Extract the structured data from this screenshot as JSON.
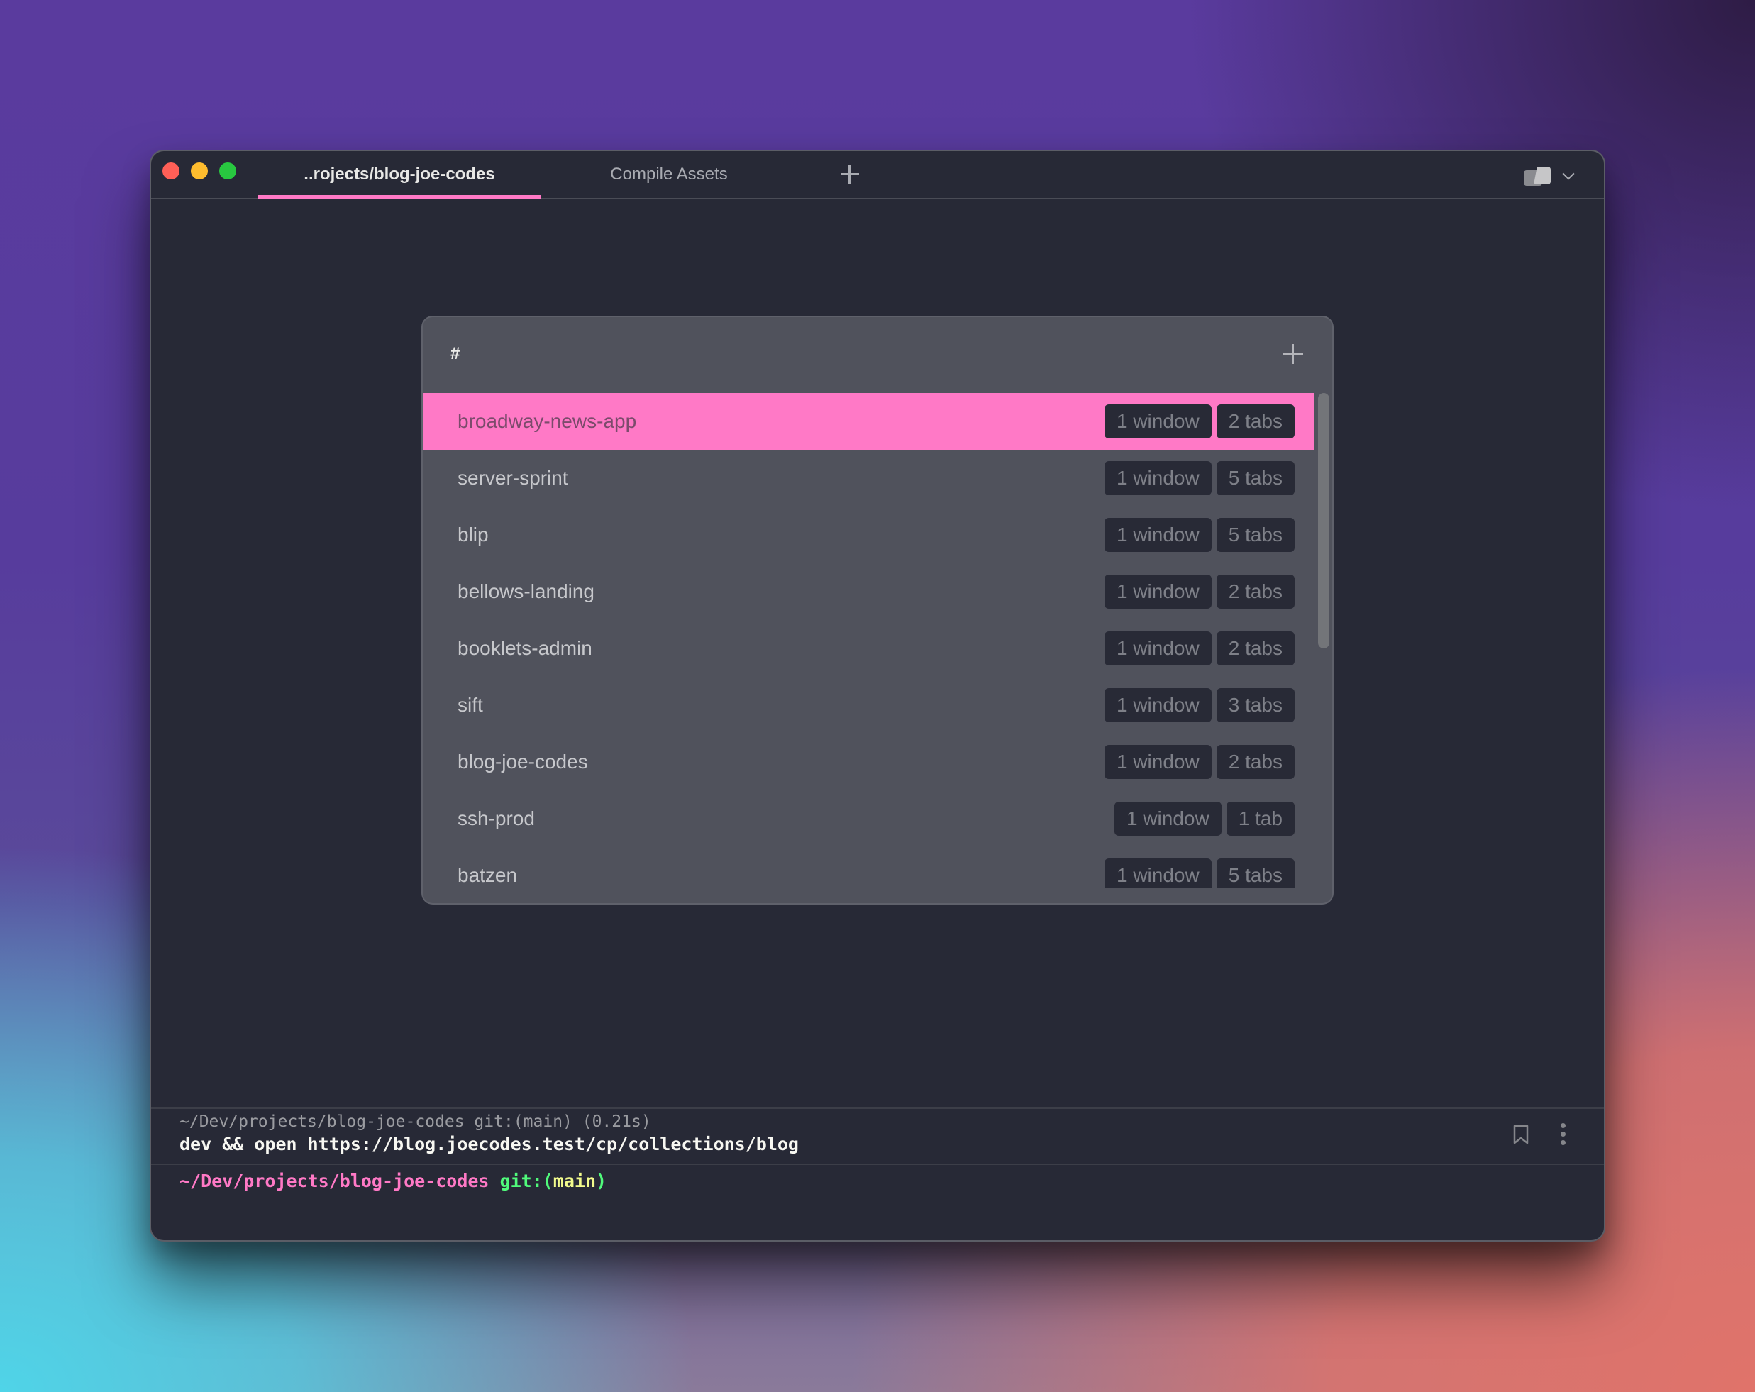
{
  "window": {
    "tabs": [
      {
        "label": "..rojects/blog-joe-codes",
        "active": true
      },
      {
        "label": "Compile Assets",
        "active": false
      }
    ],
    "new_tab_icon": "plus-icon",
    "panes_icon": "split-panes-icon",
    "accent_color": "#ff79c6"
  },
  "palette": {
    "query": "#",
    "add_icon": "plus-icon",
    "items": [
      {
        "name": "broadway-news-app",
        "windows": "1 window",
        "tabs": "2 tabs",
        "selected": true
      },
      {
        "name": "server-sprint",
        "windows": "1 window",
        "tabs": "5 tabs"
      },
      {
        "name": "blip",
        "windows": "1 window",
        "tabs": "5 tabs"
      },
      {
        "name": "bellows-landing",
        "windows": "1 window",
        "tabs": "2 tabs"
      },
      {
        "name": "booklets-admin",
        "windows": "1 window",
        "tabs": "2 tabs"
      },
      {
        "name": "sift",
        "windows": "1 window",
        "tabs": "3 tabs"
      },
      {
        "name": "blog-joe-codes",
        "windows": "1 window",
        "tabs": "2 tabs"
      },
      {
        "name": "ssh-prod",
        "windows": "1 window",
        "tabs": "1 tab"
      },
      {
        "name": "batzen",
        "windows": "1 window",
        "tabs": "5 tabs"
      }
    ]
  },
  "terminal": {
    "last_block": {
      "meta": "~/Dev/projects/blog-joe-codes git:(main) (0.21s)",
      "command": "dev && open https://blog.joecodes.test/cp/collections/blog"
    },
    "prompt": {
      "path": "~/Dev/projects/blog-joe-codes",
      "git_prefix": "git:(",
      "branch": "main",
      "git_suffix": ")"
    }
  }
}
